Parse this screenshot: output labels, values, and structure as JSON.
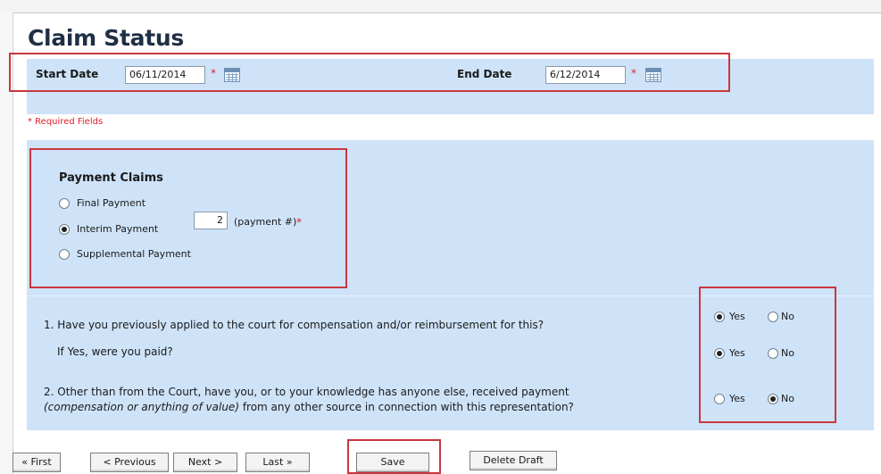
{
  "page": {
    "title": "Claim Status"
  },
  "dates": {
    "start_label": "Start Date",
    "start_value": "06/11/2014",
    "end_label": "End Date",
    "end_value": "6/12/2014",
    "required_marker": "*"
  },
  "required_note": "* Required Fields",
  "payment_claims": {
    "heading": "Payment Claims",
    "options": [
      {
        "label": "Final Payment",
        "selected": false
      },
      {
        "label": "Interim Payment",
        "selected": true
      },
      {
        "label": "Supplemental Payment",
        "selected": false
      }
    ],
    "payment_number": "2",
    "payment_number_label": "(payment #)",
    "required_marker": "*"
  },
  "questions": {
    "q1": "1. Have you previously applied to the court for compensation and/or reimbursement for this?",
    "q1_sub": "If Yes, were you paid?",
    "q2_line1": "2. Other than from the Court, have you, or to your knowledge has anyone else, received payment",
    "q2_line2_italic": "(compensation or anything of value)",
    "q2_line2_rest": " from any other source in connection with this representation?",
    "yes_label": "Yes",
    "no_label": "No",
    "answers": {
      "q1": "Yes",
      "q1_sub": "Yes",
      "q2": "No"
    }
  },
  "footer": {
    "first": "« First",
    "previous": "< Previous",
    "next": "Next >",
    "last": "Last »",
    "save": "Save",
    "delete_draft": "Delete Draft"
  },
  "colors": {
    "band": "#cfe3f8",
    "highlight_box": "#c9373f",
    "required": "#e2202a"
  }
}
